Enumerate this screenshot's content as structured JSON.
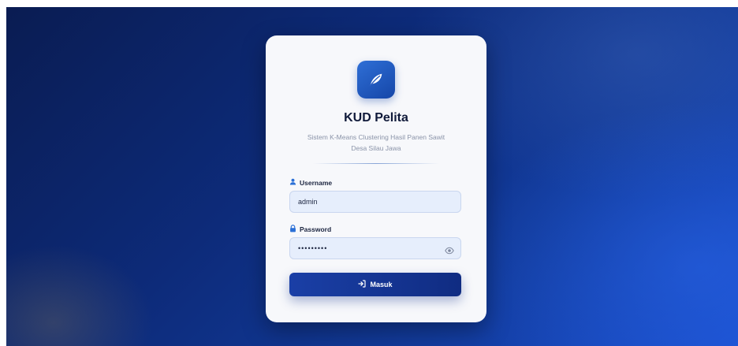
{
  "app": {
    "name": "KUD Pelita",
    "subtitle_line1": "Sistem K-Means Clustering Hasil Panen Sawit",
    "subtitle_line2": "Desa Silau Jawa"
  },
  "form": {
    "username_label": "Username",
    "username_value": "admin",
    "password_label": "Password",
    "password_value": "•••••••••",
    "submit_label": "Masuk"
  },
  "colors": {
    "accent": "#1546a8",
    "button": "#12318f",
    "background": "#0d2b7a"
  },
  "icons": {
    "logo": "leaf-icon",
    "username": "user-icon",
    "password": "lock-icon",
    "toggle": "eye-icon",
    "submit": "login-icon"
  }
}
